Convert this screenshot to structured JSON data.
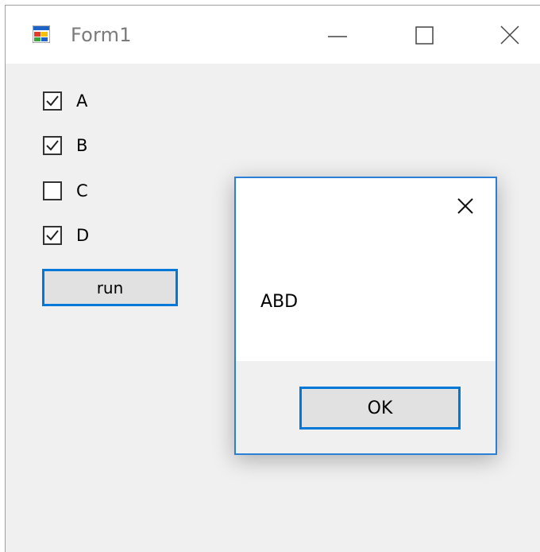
{
  "window": {
    "title": "Form1",
    "icon": "winforms-app-icon",
    "controls": [
      "minimize-icon",
      "maximize-icon",
      "close-icon"
    ]
  },
  "checkboxes": [
    {
      "label": "A",
      "checked": true
    },
    {
      "label": "B",
      "checked": true
    },
    {
      "label": "C",
      "checked": false
    },
    {
      "label": "D",
      "checked": true
    }
  ],
  "run_button": {
    "label": "run"
  },
  "message_box": {
    "message": "ABD",
    "ok_label": "OK",
    "close_icon": "close-icon"
  },
  "colors": {
    "accent": "#0078d7",
    "window_bg": "#f0f0f0",
    "titlebar_bg": "#ffffff",
    "dialog_footer_bg": "#f0f0f0"
  }
}
